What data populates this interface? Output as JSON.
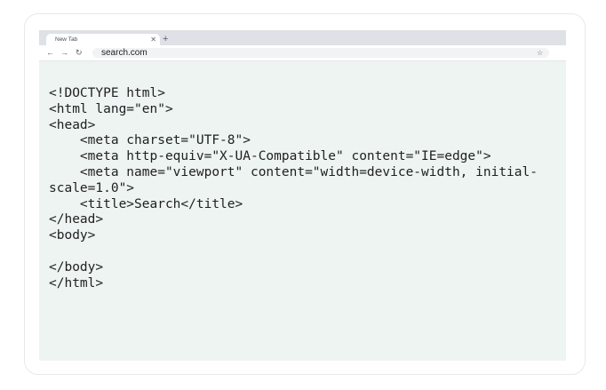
{
  "browser": {
    "tab_title": "New Tab",
    "url": "search.com"
  },
  "icons": {
    "tab_close": "close-icon",
    "new_tab": "plus-icon",
    "back": "arrow-left-icon",
    "forward": "arrow-right-icon",
    "reload": "reload-icon",
    "bookmark": "star-icon",
    "menu": "more-vertical-icon"
  },
  "code_lines": [
    "<!DOCTYPE html>",
    "<html lang=\"en\">",
    "<head>",
    "    <meta charset=\"UTF-8\">",
    "    <meta http-equiv=\"X-UA-Compatible\" content=\"IE=edge\">",
    "    <meta name=\"viewport\" content=\"width=device-width, initial-",
    "scale=1.0\">",
    "    <title>Search</title>",
    "</head>",
    "<body>",
    "",
    "</body>",
    "</html>"
  ],
  "colors": {
    "page_background": "#eef4f2",
    "tabstrip": "#dee1e6",
    "text": "#202124"
  }
}
